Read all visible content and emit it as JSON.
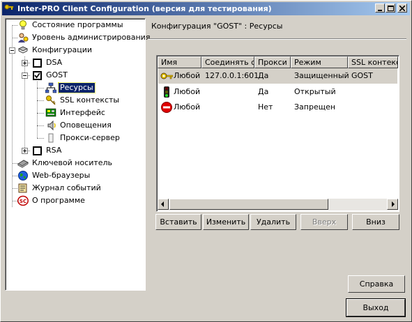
{
  "window": {
    "title": "Inter-PRO Client Configuration (версия для тестирования)",
    "buttons": {
      "minimize": "_",
      "maximize": "□",
      "close": "×"
    }
  },
  "tree": {
    "items": [
      {
        "label": "Состояние программы",
        "icon": "bulb-icon"
      },
      {
        "label": "Уровень администрирования",
        "icon": "admin-icon"
      },
      {
        "label": "Конфигурации",
        "icon": "configs-icon",
        "expanded": true
      },
      {
        "label": "DSA",
        "checked": false,
        "expanded": false
      },
      {
        "label": "GOST",
        "checked": true,
        "expanded": true
      },
      {
        "label": "Ресурсы",
        "icon": "network-icon",
        "selected": true
      },
      {
        "label": "SSL контексты",
        "icon": "key-icon"
      },
      {
        "label": "Интерфейс",
        "icon": "interface-icon"
      },
      {
        "label": "Оповещения",
        "icon": "speaker-icon"
      },
      {
        "label": "Прокси-сервер",
        "icon": "proxy-icon"
      },
      {
        "label": "RSA",
        "checked": false,
        "expanded": false
      },
      {
        "label": "Ключевой носитель",
        "icon": "disk-icon"
      },
      {
        "label": "Web-браузеры",
        "icon": "globe-icon"
      },
      {
        "label": "Журнал событий",
        "icon": "journal-icon"
      },
      {
        "label": "О программе",
        "icon": "about-icon",
        "icon_text": "SC"
      }
    ]
  },
  "panel": {
    "title": "Конфигурация \"GOST\" :  Ресурсы"
  },
  "list": {
    "columns": [
      "Имя",
      "Соединять с",
      "Прокси",
      "Режим",
      "SSL контекст"
    ],
    "rows": [
      {
        "icon": "key-icon",
        "name": "Любой",
        "connect": "127.0.0.1:601",
        "proxy": "Да",
        "mode": "Защищенный",
        "ssl": "GOST"
      },
      {
        "icon": "traffic-light-icon",
        "name": "Любой",
        "connect": "",
        "proxy": "Да",
        "mode": "Открытый",
        "ssl": ""
      },
      {
        "icon": "no-entry-icon",
        "name": "Любой",
        "connect": "",
        "proxy": "Нет",
        "mode": "Запрещен",
        "ssl": ""
      }
    ]
  },
  "actions": {
    "insert": "Вставить",
    "edit": "Изменить",
    "delete": "Удалить",
    "up": "Вверх",
    "down": "Вниз"
  },
  "footer": {
    "help": "Справка",
    "exit": "Выход"
  }
}
